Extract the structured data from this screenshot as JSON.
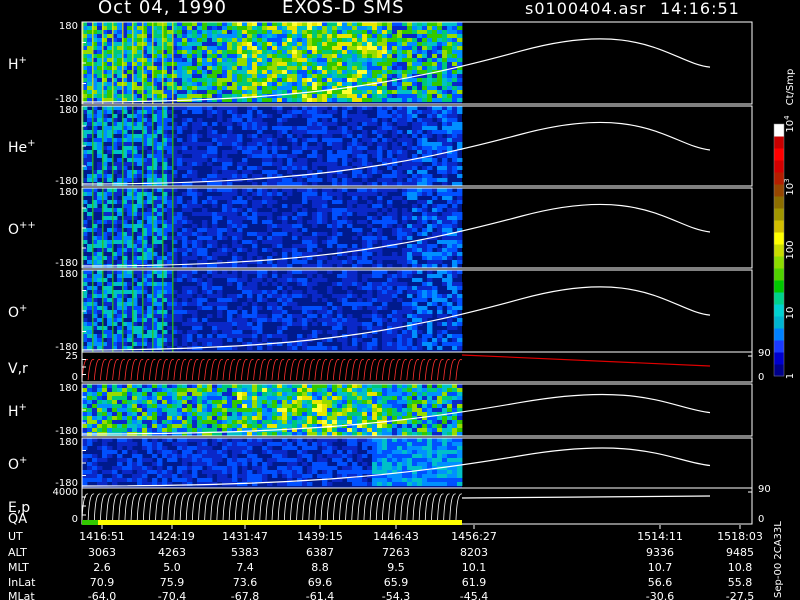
{
  "header": {
    "date": "Oct 04, 1990",
    "mission": "EXOS-D SMS",
    "file": "s0100404.asr",
    "time": "14:16:51"
  },
  "chart_data": {
    "type": "heatmap",
    "panels": [
      {
        "label": "H",
        "sup": "+",
        "ymax": "180",
        "ymin": "-180",
        "kind": "spec"
      },
      {
        "label": "He",
        "sup": "+",
        "ymax": "180",
        "ymin": "-180",
        "kind": "spec"
      },
      {
        "label": "O",
        "sup": "++",
        "ymax": "180",
        "ymin": "-180",
        "kind": "spec"
      },
      {
        "label": "O",
        "sup": "+",
        "ymax": "180",
        "ymin": "-180",
        "kind": "spec"
      },
      {
        "label": "V,r",
        "sup": "",
        "ymax": "25",
        "ymin": "0",
        "kind": "line",
        "right_max": "90",
        "right_min": "0"
      },
      {
        "label": "H",
        "sup": "+",
        "ymax": "180",
        "ymin": "-180",
        "kind": "spec"
      },
      {
        "label": "O",
        "sup": "+",
        "ymax": "180",
        "ymin": "-180",
        "kind": "spec"
      },
      {
        "label": "E,p",
        "sup": "",
        "ymax": "4000",
        "ymin": "0",
        "kind": "line",
        "right_max": "90",
        "right_min": "0"
      }
    ],
    "qa_label": "QA",
    "colorbar": {
      "title": "Ct/Smp",
      "ticks": [
        {
          "label": "1",
          "frac": 0.0
        },
        {
          "label": "10",
          "frac": 0.25
        },
        {
          "label": "100",
          "frac": 0.5
        },
        {
          "label": "10^3",
          "frac": 0.75
        },
        {
          "label": "10^4",
          "frac": 1.0
        }
      ],
      "colors": [
        "#00008b",
        "#0000cd",
        "#1a3aff",
        "#0080ff",
        "#00b4d2",
        "#00d2d2",
        "#00d28c",
        "#00c800",
        "#50d200",
        "#8cdc00",
        "#c8dc00",
        "#ffff00",
        "#d2be00",
        "#a09600",
        "#8c6e00",
        "#964600",
        "#b41e00",
        "#d20000",
        "#ff0000",
        "#c80000",
        "#ffffff"
      ]
    },
    "time_axis": {
      "columns": [
        "1416:51",
        "1424:19",
        "1431:47",
        "1439:15",
        "1446:43",
        "1456:27",
        "1514:11",
        "1518:03"
      ]
    },
    "ephemeris": [
      {
        "label": "UT",
        "values": [
          "1416:51",
          "1424:19",
          "1431:47",
          "1439:15",
          "1446:43",
          "1456:27",
          "1514:11",
          "1518:03"
        ]
      },
      {
        "label": "ALT",
        "values": [
          "3063",
          "4263",
          "5383",
          "6387",
          "7263",
          "8203",
          "9336",
          "9485"
        ]
      },
      {
        "label": "MLT",
        "values": [
          "2.6",
          "5.0",
          "7.4",
          "8.8",
          "9.5",
          "10.1",
          "10.7",
          "10.8"
        ]
      },
      {
        "label": "InLat",
        "values": [
          "70.9",
          "75.9",
          "73.6",
          "69.6",
          "65.9",
          "61.9",
          "56.6",
          "55.8"
        ]
      },
      {
        "label": "MLat",
        "values": [
          "-64.0",
          "-70.4",
          "-67.8",
          "-61.4",
          "-54.3",
          "-45.4",
          "-30.6",
          "-27.5"
        ]
      }
    ],
    "footer_note": "Sep-00 2CA33L"
  }
}
